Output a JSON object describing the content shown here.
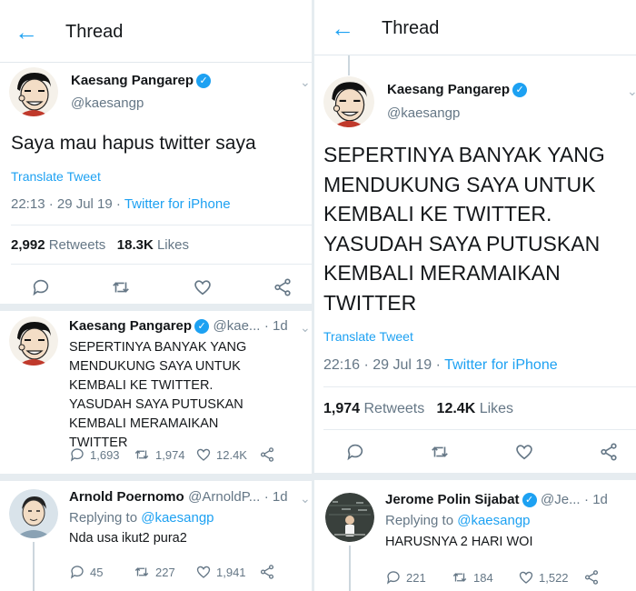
{
  "header": {
    "title": "Thread"
  },
  "left": {
    "main": {
      "name": "Kaesang Pangarep",
      "handle": "@kaesangp",
      "text": "Saya mau hapus twitter saya",
      "translate": "Translate Tweet",
      "time": "22:13 · 29 Jul 19 · ",
      "source": "Twitter for iPhone",
      "retweets_count": "2,992",
      "retweets_label": "Retweets",
      "likes_count": "18.3K",
      "likes_label": "Likes"
    },
    "reply1": {
      "name": "Kaesang Pangarep",
      "handle": "@kae...",
      "age": "· 1d",
      "text": "SEPERTINYA BANYAK YANG MENDUKUNG SAYA UNTUK KEMBALI KE TWITTER. YASUDAH SAYA PUTUSKAN KEMBALI MERAMAIKAN TWITTER",
      "replies": "1,693",
      "retweets": "1,974",
      "likes": "12.4K"
    },
    "reply2": {
      "name": "Arnold Poernomo",
      "handle": "@ArnoldP...",
      "age": "· 1d",
      "replying_prefix": "Replying to ",
      "replying_to": "@kaesangp",
      "text": "Nda usa ikut2 pura2",
      "replies": "45",
      "retweets": "227",
      "likes": "1,941"
    }
  },
  "right": {
    "main": {
      "name": "Kaesang Pangarep",
      "handle": "@kaesangp",
      "text_lines": [
        "SEPERTINYA BANYAK YANG",
        "MENDUKUNG SAYA UNTUK",
        "KEMBALI KE TWITTER.",
        "YASUDAH SAYA PUTUSKAN",
        "KEMBALI MERAMAIKAN",
        "TWITTER"
      ],
      "translate": "Translate Tweet",
      "time": "22:16 · 29 Jul 19 · ",
      "source": "Twitter for iPhone",
      "retweets_count": "1,974",
      "retweets_label": "Retweets",
      "likes_count": "12.4K",
      "likes_label": "Likes"
    },
    "reply": {
      "name": "Jerome Polin Sijabat",
      "handle": "@Je...",
      "age": "· 1d",
      "replying_prefix": "Replying to ",
      "replying_to": "@kaesangp",
      "text": "HARUSNYA 2 HARI WOI",
      "replies": "221",
      "retweets": "184",
      "likes": "1,522"
    }
  },
  "icons": {
    "back": "back-arrow-icon",
    "reply": "reply-icon",
    "retweet": "retweet-icon",
    "like": "heart-icon",
    "share": "share-icon",
    "verified": "verified-badge-icon",
    "menu": "chevron-down-icon"
  },
  "colors": {
    "accent": "#1da1f2",
    "text": "#14171a",
    "secondary": "#657786",
    "divider": "#e6ecf0"
  }
}
